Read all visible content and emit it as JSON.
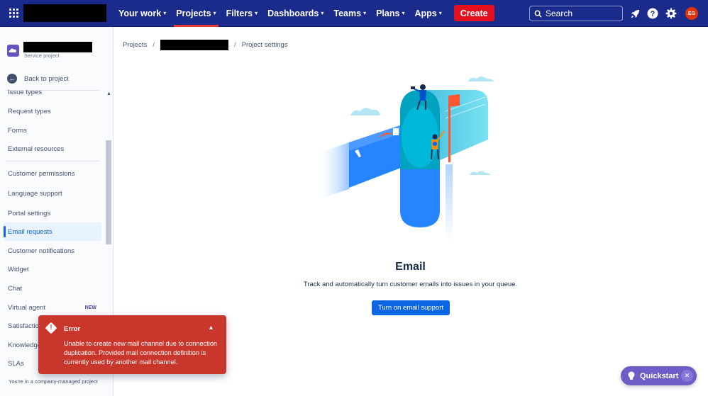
{
  "topnav": {
    "items": [
      {
        "label": "Your work",
        "active": false
      },
      {
        "label": "Projects",
        "active": true
      },
      {
        "label": "Filters",
        "active": false
      },
      {
        "label": "Dashboards",
        "active": false
      },
      {
        "label": "Teams",
        "active": false
      },
      {
        "label": "Plans",
        "active": false
      },
      {
        "label": "Apps",
        "active": false
      }
    ],
    "create_label": "Create",
    "search_placeholder": "Search",
    "avatar_initials": "EG"
  },
  "sidebar": {
    "project_type": "Service project",
    "back_label": "Back to project",
    "items": [
      {
        "label": "Issue types"
      },
      {
        "label": "Request types"
      },
      {
        "label": "Forms"
      },
      {
        "label": "External resources"
      },
      {
        "label": "Customer permissions"
      },
      {
        "label": "Language support"
      },
      {
        "label": "Portal settings"
      },
      {
        "label": "Email requests",
        "selected": true
      },
      {
        "label": "Customer notifications"
      },
      {
        "label": "Widget"
      },
      {
        "label": "Chat"
      },
      {
        "label": "Virtual agent",
        "badge": "NEW"
      },
      {
        "label": "Satisfaction"
      },
      {
        "label": "Knowledge"
      },
      {
        "label": "SLAs"
      }
    ],
    "footer": "You're in a company-managed project"
  },
  "breadcrumb": {
    "root": "Projects",
    "current": "Project settings"
  },
  "empty_state": {
    "title": "Email",
    "description": "Track and automatically turn customer emails into issues in your queue.",
    "button_label": "Turn on email support"
  },
  "error_flag": {
    "title": "Error",
    "message": "Unable to create new mail channel due to connection duplication. Provided mail connection definition is currently used by another mail channel."
  },
  "quickstart": {
    "label": "Quickstart"
  },
  "colors": {
    "nav_bg": "#1b2b8c",
    "create": "#e5101f",
    "primary": "#0c66e4",
    "error": "#c9372c",
    "quickstart": "#6e5dc6"
  }
}
